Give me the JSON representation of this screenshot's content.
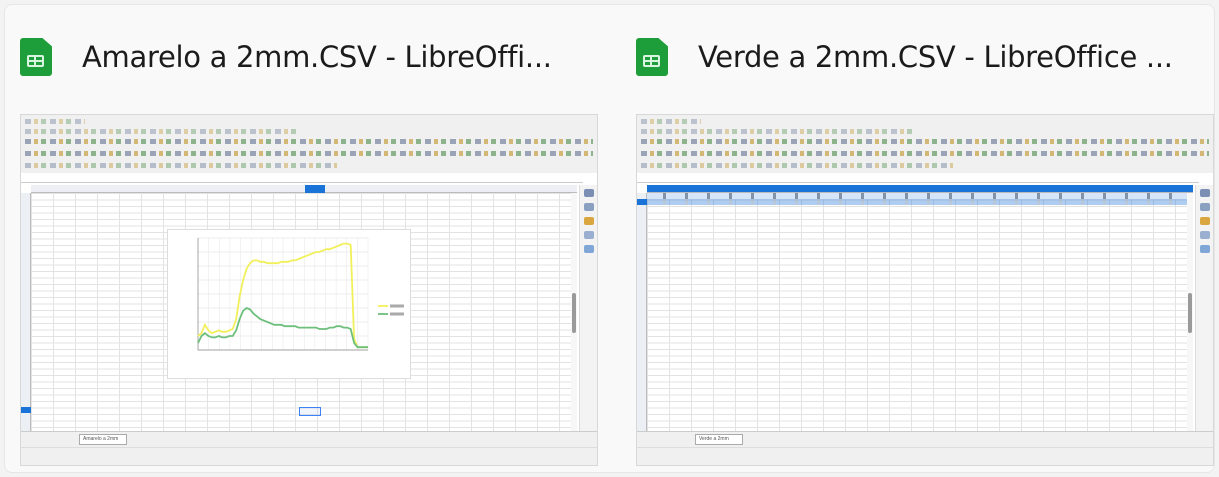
{
  "windows": [
    {
      "title": "Amarelo a 2mm.CSV - LibreOffi...",
      "icon": "calc-spreadsheet-icon",
      "sheet_tab": "Amarelo a 2mm",
      "chart_data": {
        "type": "line",
        "x": [
          1,
          2,
          3,
          4,
          5,
          6,
          7,
          8,
          9,
          10,
          11,
          12,
          13,
          14,
          15,
          16,
          17,
          18,
          19,
          20,
          21,
          22,
          23,
          24,
          25,
          26,
          27,
          28,
          29,
          30,
          31,
          32,
          33,
          34,
          35,
          36,
          37,
          38,
          39,
          40,
          41,
          42,
          43,
          44,
          45,
          46,
          47,
          48,
          49,
          50
        ],
        "series": [
          {
            "color": "#f2f05a",
            "values": [
              10,
              12,
              18,
              14,
              12,
              13,
              14,
              13,
              13,
              14,
              15,
              22,
              38,
              50,
              58,
              62,
              64,
              64,
              63,
              63,
              62,
              62,
              62,
              62,
              63,
              63,
              63,
              64,
              64,
              65,
              66,
              67,
              68,
              69,
              70,
              70,
              71,
              72,
              72,
              73,
              74,
              75,
              76,
              76,
              75,
              8,
              2,
              2,
              2,
              2
            ]
          },
          {
            "color": "#6dbf7c",
            "values": [
              5,
              10,
              12,
              10,
              9,
              9,
              10,
              9,
              9,
              10,
              10,
              14,
              22,
              28,
              30,
              29,
              26,
              24,
              22,
              21,
              20,
              19,
              18,
              18,
              18,
              17,
              17,
              17,
              17,
              16,
              16,
              16,
              16,
              16,
              16,
              15,
              15,
              15,
              16,
              16,
              17,
              17,
              16,
              16,
              15,
              5,
              2,
              2,
              2,
              2
            ]
          }
        ],
        "ylim": [
          0,
          80
        ]
      }
    },
    {
      "title": "Verde a 2mm.CSV - LibreOffice ...",
      "icon": "calc-spreadsheet-icon",
      "sheet_tab": "Verde a 2mm"
    }
  ],
  "colors": {
    "selection": "#1a73d6",
    "app_icon": "#1e9e3a"
  }
}
